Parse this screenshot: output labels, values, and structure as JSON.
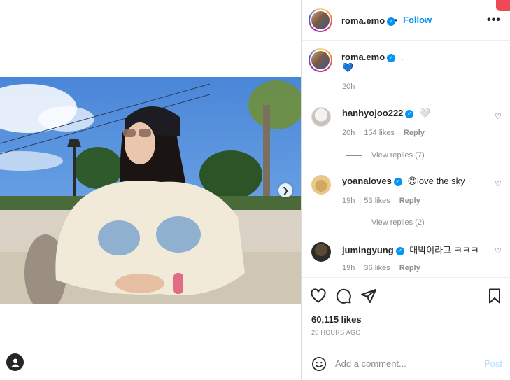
{
  "post": {
    "author": "roma.emo",
    "follow_label": "Follow",
    "separator": "•",
    "more_label": "•••"
  },
  "caption": {
    "author": "roma.emo",
    "text": ".",
    "emoji": "💙",
    "time": "20h"
  },
  "comments": [
    {
      "user": "hanhyojoo222",
      "text": "🤍",
      "time": "20h",
      "likes": "154 likes",
      "reply": "Reply",
      "view_replies": "View replies (7)"
    },
    {
      "user": "yoanaloves",
      "text": "😍love the sky",
      "time": "19h",
      "likes": "53 likes",
      "reply": "Reply",
      "view_replies": "View replies (2)"
    },
    {
      "user": "jumingyung",
      "text": "대박이라그 ㅋㅋㅋ",
      "time": "19h",
      "likes": "36 likes",
      "reply": "Reply"
    }
  ],
  "stats": {
    "likes": "60,115 likes",
    "time_ago": "20 HOURS AGO"
  },
  "comment_bar": {
    "placeholder": "Add a comment...",
    "post_label": "Post"
  },
  "icons": {
    "like": "heart-icon",
    "comment": "comment-icon",
    "share": "paper-plane-icon",
    "save": "bookmark-icon",
    "emoji": "smiley-icon",
    "next": "chevron-right-icon",
    "tag": "user-tag-icon"
  },
  "colors": {
    "accent": "#0095f6",
    "muted": "#8e8e8e",
    "text": "#262626",
    "badge": "#ed4956"
  }
}
